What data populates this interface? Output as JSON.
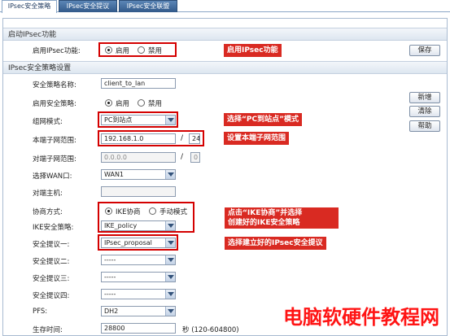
{
  "tabs": [
    "IPsec安全策略",
    "IPsec安全提议",
    "IPsec安全联盟"
  ],
  "enable_section": {
    "title": "启动IPsec功能",
    "label": "启用IPsec功能:",
    "options": [
      "启用",
      "禁用"
    ],
    "selected": "启用",
    "save_label": "保存"
  },
  "policy_section": {
    "title": "IPsec安全策略设置",
    "fields": {
      "policy_name_label": "安全策略名称:",
      "policy_name_value": "client_to_lan",
      "enable_policy_label": "启用安全策略:",
      "enable_policy_options": [
        "启用",
        "禁用"
      ],
      "networking_mode_label": "组网模式:",
      "networking_mode_value": "PC到站点",
      "local_subnet_label": "本端子网范围:",
      "local_subnet_ip": "192.168.1.0",
      "local_subnet_mask": "24",
      "remote_subnet_label": "对端子网范围:",
      "remote_subnet_ip": "0.0.0.0",
      "remote_subnet_mask": "0",
      "wan_label": "选择WAN口:",
      "wan_value": "WAN1",
      "remote_host_label": "对端主机:",
      "remote_host_value": "",
      "negotiation_label": "协商方式:",
      "negotiation_options": [
        "IKE协商",
        "手动模式"
      ],
      "ike_policy_label": "IKE安全策略:",
      "ike_policy_value": "IKE_policy",
      "proposal1_label": "安全提议一:",
      "proposal1_value": "IPsec_proposal",
      "proposal2_label": "安全提议二:",
      "proposal2_value": "-----",
      "proposal3_label": "安全提议三:",
      "proposal3_value": "-----",
      "proposal4_label": "安全提议四:",
      "proposal4_value": "-----",
      "pfs_label": "PFS:",
      "pfs_value": "DH2",
      "lifetime_label": "生存时间:",
      "lifetime_value": "28800",
      "lifetime_unit": "秒 (120-604800)"
    },
    "buttons": {
      "add": "新增",
      "clear": "清除",
      "help": "帮助"
    }
  },
  "annotations": {
    "enable_ipsec": "启用IPsec功能",
    "select_mode": "选择“PC到站点”模式",
    "set_subnet": "设置本端子网范围",
    "ike_line1": "点击“IKE协商”并选择",
    "ike_line2": "创建好的IKE安全策略",
    "proposal": "选择建立好的IPsec安全提议"
  },
  "watermark": "电脑软硬件教程网",
  "colors": {
    "annotation_red": "#d92a22",
    "highlight_box": "#d40000",
    "tab_blue": "#31598a"
  }
}
